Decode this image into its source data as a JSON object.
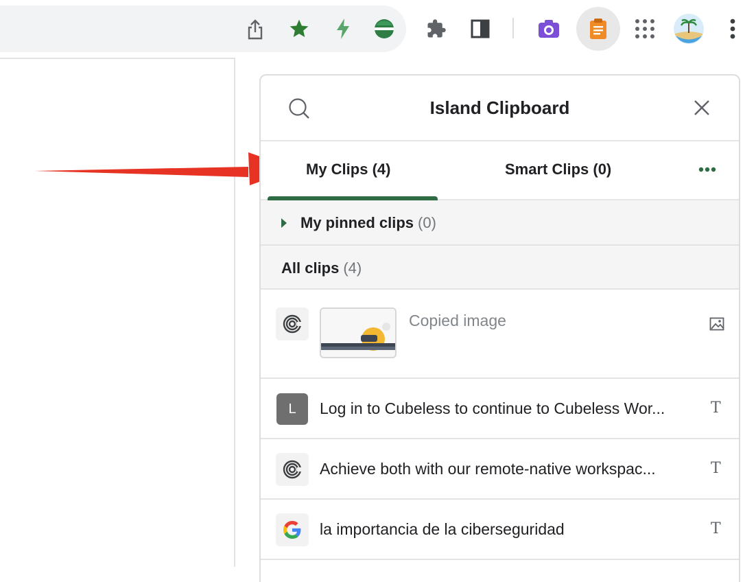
{
  "toolbar": {
    "icons": [
      "share-icon",
      "bookmark-star-icon",
      "lightning-extension-icon",
      "green-circle-extension-icon",
      "puzzle-extensions-icon",
      "side-panel-icon",
      "camera-extension-icon",
      "clipboard-extension-icon",
      "apps-grid-icon",
      "profile-avatar",
      "more-menu-icon"
    ],
    "colors": {
      "star": "#2e7d32",
      "camera": "#7b4fd6",
      "clipboard": "#f08a24",
      "active_bg": "#e8e8e8"
    }
  },
  "clipboard_panel": {
    "title": "Island Clipboard",
    "tabs": [
      {
        "label": "My Clips (4)",
        "active": true
      },
      {
        "label": "Smart Clips (0)",
        "active": false
      }
    ],
    "pinned_section": {
      "label": "My pinned clips",
      "count": "(0)"
    },
    "all_section": {
      "label": "All clips",
      "count": "(4)"
    },
    "clips": [
      {
        "source_icon": "island-swirl-icon",
        "text": "Copied image",
        "type_icon": "image-type-icon"
      },
      {
        "source_icon": "letter-l-icon",
        "source_letter": "L",
        "text": "Log in to Cubeless to continue to Cubeless Wor...",
        "type_icon": "text-type-icon",
        "type_glyph": "T"
      },
      {
        "source_icon": "island-swirl-icon",
        "text": "Achieve both with our remote-native workspac...",
        "type_icon": "text-type-icon",
        "type_glyph": "T"
      },
      {
        "source_icon": "google-g-icon",
        "text": "la importancia de la ciberseguridad",
        "type_icon": "text-type-icon",
        "type_glyph": "T"
      }
    ],
    "accent_color": "#2f6b43"
  },
  "annotation": {
    "arrow_color": "#e63323"
  }
}
